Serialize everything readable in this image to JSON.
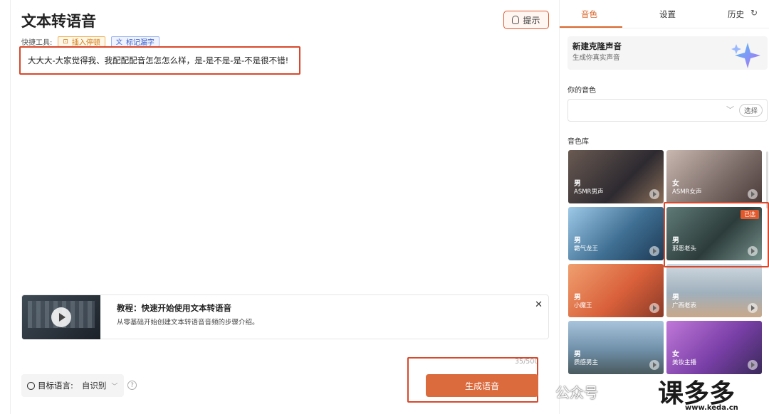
{
  "page": {
    "title": "文本转语音"
  },
  "toolbar": {
    "tip_label": "提示",
    "quick_tools_label": "快捷工具:",
    "insert_pause_label": "插入停顿",
    "mark_word_label": "标记漏字"
  },
  "editor": {
    "text": "大大大-大家觉得我、我配配配音怎怎怎么样，是-是不是-是-不是很不错!",
    "char_count": "35/500"
  },
  "tutorial": {
    "title": "教程：快速开始使用文本转语音",
    "description": "从零基础开始创建文本转语音音频的步骤介绍。"
  },
  "language": {
    "label": "目标语言:",
    "value": "自识别"
  },
  "generate_label": "生成语音",
  "side": {
    "tabs": [
      {
        "label": "音色",
        "active": true
      },
      {
        "label": "设置",
        "active": false
      },
      {
        "label": "历史",
        "active": false
      }
    ],
    "clone": {
      "title": "新建克隆声音",
      "subtitle": "生成你真实声音"
    },
    "your_voice_label": "你的音色",
    "select_label": "选择",
    "library_label": "音色库",
    "voices": [
      {
        "gender": "男",
        "name": "ASMR男声",
        "selected": false
      },
      {
        "gender": "女",
        "name": "ASMR女声",
        "selected": false
      },
      {
        "gender": "男",
        "name": "霸气龙王",
        "selected": false
      },
      {
        "gender": "男",
        "name": "邪恶老头",
        "selected": true
      },
      {
        "gender": "男",
        "name": "小魔王",
        "selected": false
      },
      {
        "gender": "男",
        "name": "广西老表",
        "selected": false
      },
      {
        "gender": "男",
        "name": "质感男主",
        "selected": false
      },
      {
        "gender": "女",
        "name": "美妆主播",
        "selected": false
      }
    ],
    "selected_tag": "已选"
  },
  "watermark": {
    "text": "公众号",
    "brand": "课多多",
    "url": "www.keda.cn"
  },
  "colors": {
    "accent": "#db6a3d",
    "highlight": "#d9482b"
  }
}
